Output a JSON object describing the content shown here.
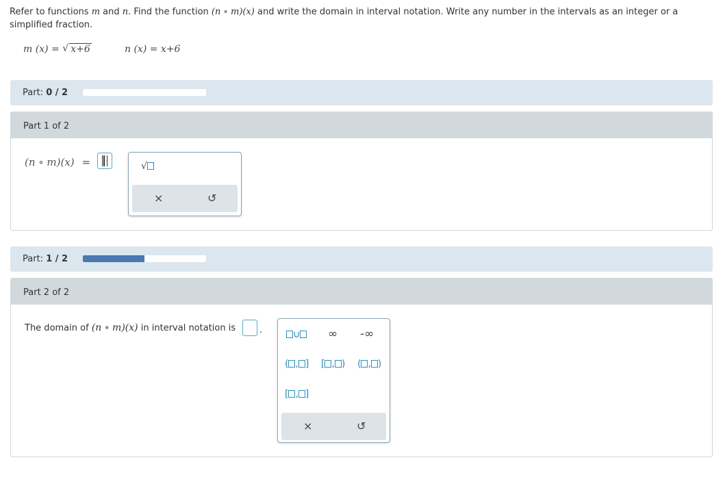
{
  "question": {
    "text_pre": "Refer to functions",
    "var_m": "m",
    "text_and": "and",
    "var_n": "n",
    "text_find": ". Find the function",
    "composition": "(n ∘ m)(x)",
    "text_post": "and write the domain in interval notation. Write any number in the intervals as an integer or a simplified fraction."
  },
  "formulas": {
    "m_lhs": "m (x) =",
    "m_radicand": "x+6",
    "n_def": "n (x) = x+6"
  },
  "part_progress_1": {
    "label": "Part:",
    "value": "0 / 2",
    "progress": 0.0
  },
  "part1": {
    "heading": "Part 1 of 2",
    "equation_lhs": "(n ∘ m)(x)",
    "equals": "=",
    "palette": {
      "sqrt_button": "√□",
      "clear": "×",
      "undo": "↺"
    }
  },
  "part_progress_2": {
    "label": "Part:",
    "value": "1 / 2",
    "progress": 0.5
  },
  "part2": {
    "heading": "Part 2 of 2",
    "prompt_pre": "The domain of",
    "prompt_math": "(n ∘ m)(x)",
    "prompt_post": "in interval notation is",
    "period": ".",
    "palette": {
      "union": "∪",
      "infinity": "∞",
      "neg_infinity": "-∞",
      "interval_open_closed": [
        "(",
        ",",
        "]"
      ],
      "interval_closed_open": [
        "[",
        ",",
        ")"
      ],
      "interval_open_open": [
        "(",
        ",",
        ")"
      ],
      "interval_closed_closed": [
        "[",
        ",",
        "]"
      ],
      "clear": "×",
      "undo": "↺"
    }
  },
  "colors": {
    "accent": "#2a8fbd",
    "progress_fill": "#4a78b0",
    "bar_bg": "#dce6ef",
    "header_bg": "#d1d9dd"
  }
}
